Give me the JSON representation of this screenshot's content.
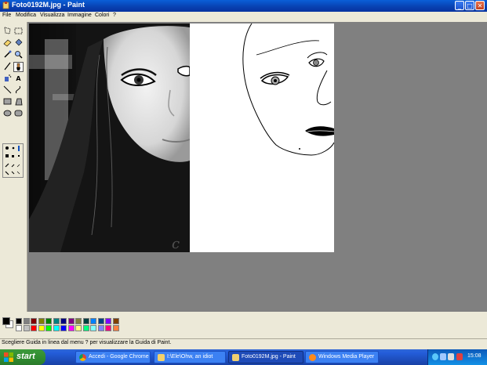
{
  "window": {
    "title": "Foto0192M.jpg - Paint",
    "minimize_icon": "minimize-icon",
    "maximize_icon": "maximize-icon",
    "close_icon": "close-icon",
    "title_color": "#0a5fd8"
  },
  "menu": {
    "items": [
      "File",
      "Modifica",
      "Visualizza",
      "Immagine",
      "Colori",
      "?"
    ]
  },
  "toolbox": {
    "tools": [
      "free-select-icon",
      "rect-select-icon",
      "eraser-icon",
      "fill-icon",
      "color-picker-icon",
      "magnifier-icon",
      "pencil-icon",
      "brush-icon",
      "airbrush-icon",
      "text-icon",
      "line-icon",
      "curve-icon",
      "rectangle-icon",
      "polygon-icon",
      "ellipse-icon",
      "rounded-rect-icon"
    ],
    "text_tool_glyph": "A",
    "active_tool": "brush-icon"
  },
  "palette": {
    "foreground": "#000000",
    "background": "#ffffff",
    "colors": [
      "#000000",
      "#808080",
      "#800000",
      "#808000",
      "#008000",
      "#008080",
      "#000080",
      "#800080",
      "#808040",
      "#004040",
      "#0080ff",
      "#004080",
      "#8000ff",
      "#804000",
      "#ffffff",
      "#c0c0c0",
      "#ff0000",
      "#ffff00",
      "#00ff00",
      "#00ffff",
      "#0000ff",
      "#ff00ff",
      "#ffff80",
      "#00ff80",
      "#80ffff",
      "#8080ff",
      "#ff0080",
      "#ff8040"
    ]
  },
  "statusbar": {
    "text": "Scegliere Guida in linea dal menu ? per visualizzare la Guida di Paint."
  },
  "taskbar": {
    "start_label": "start",
    "tasks": [
      {
        "label": "Accedi - Google Chrome",
        "icon": "chrome-icon"
      },
      {
        "label": "I:\\Ele\\Ohw, an idiot",
        "icon": "folder-icon"
      },
      {
        "label": "Foto0192M.jpg - Paint",
        "icon": "paint-icon"
      },
      {
        "label": "Windows Media Player",
        "icon": "media-player-icon"
      }
    ],
    "clock": "15:08"
  }
}
